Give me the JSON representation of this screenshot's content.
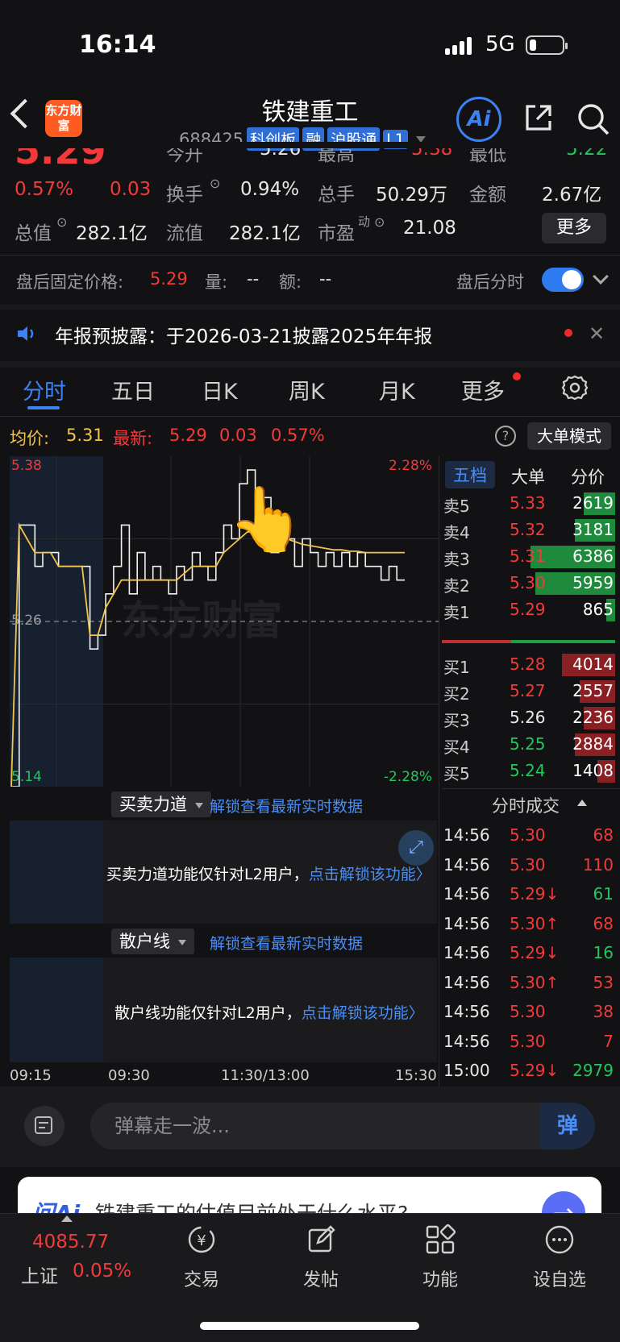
{
  "status": {
    "time": "16:14",
    "network": "5G"
  },
  "header": {
    "logo": "东方财富",
    "title": "铁建重工",
    "code": "688425",
    "tags": [
      "科创板",
      "融",
      "沪股通",
      "L1"
    ],
    "ai_label": "Ai"
  },
  "quote": {
    "price": "5.29",
    "change_pct": "0.57%",
    "change": "0.03",
    "r0": {
      "open_label": "今开",
      "open": "5.26",
      "high_label": "最高",
      "high": "5.38",
      "low_label": "最低",
      "low": "5.22"
    },
    "r1": {
      "turnover_label": "换手",
      "turnover": "0.94%",
      "volume_label": "总手",
      "volume": "50.29万",
      "amount_label": "金额",
      "amount": "2.67亿"
    },
    "r2": {
      "mcap_label": "总值",
      "mcap": "282.1亿",
      "float_label": "流值",
      "float": "282.1亿",
      "pe_label": "市盈",
      "pe_sup": "动",
      "pe": "21.08"
    },
    "more_label": "更多"
  },
  "after_hours": {
    "label": "盘后固定价格:",
    "price": "5.29",
    "vol_label": "量:",
    "vol": "--",
    "amt_label": "额:",
    "amt": "--",
    "toggle_label": "盘后分时"
  },
  "notice": {
    "text": "年报预披露：于2026-03-21披露2025年年报"
  },
  "tabs": [
    "分时",
    "五日",
    "日K",
    "周K",
    "月K",
    "更多"
  ],
  "price_line": {
    "avg_label": "均价:",
    "avg": "5.31",
    "latest_label": "最新:",
    "latest": "5.29",
    "change": "0.03",
    "pct": "0.57%",
    "mode_label": "大单模式"
  },
  "chart_labels": {
    "high": "5.38",
    "high_pct": "2.28%",
    "mid": "5.26",
    "low": "5.14",
    "low_pct": "-2.28%",
    "watermark": "东方财富"
  },
  "chart_data": {
    "type": "line",
    "ylim": [
      5.14,
      5.38
    ],
    "prev_close": 5.26,
    "series": [
      {
        "values": [
          5.14,
          5.33,
          5.33,
          5.3,
          5.31,
          5.31,
          5.3,
          5.3,
          5.3,
          5.3,
          5.24,
          5.25,
          5.28,
          5.3,
          5.33,
          5.28,
          5.31,
          5.29,
          5.3,
          5.29,
          5.28,
          5.3,
          5.29,
          5.31,
          5.3,
          5.29,
          5.31,
          5.33,
          5.32,
          5.36,
          5.37,
          5.34,
          5.35,
          5.31,
          5.33,
          5.32,
          5.3,
          5.32,
          5.31,
          5.3,
          5.31,
          5.3,
          5.31,
          5.3,
          5.31,
          5.3,
          5.3,
          5.29,
          5.3,
          5.29,
          5.29
        ]
      },
      {
        "values": [
          5.14,
          5.33,
          5.32,
          5.31,
          5.31,
          5.31,
          5.3,
          5.3,
          5.3,
          5.3,
          5.25,
          5.25,
          5.27,
          5.28,
          5.29,
          5.29,
          5.29,
          5.29,
          5.29,
          5.29,
          5.29,
          5.29,
          5.295,
          5.3,
          5.3,
          5.3,
          5.3,
          5.31,
          5.315,
          5.32,
          5.325,
          5.325,
          5.325,
          5.325,
          5.322,
          5.32,
          5.318,
          5.316,
          5.315,
          5.314,
          5.313,
          5.312,
          5.312,
          5.311,
          5.311,
          5.31,
          5.31,
          5.31,
          5.31,
          5.31,
          5.31
        ]
      }
    ]
  },
  "order_book": {
    "tabs": [
      "五档",
      "大单",
      "分价"
    ],
    "asks": [
      {
        "label": "卖5",
        "price": "5.33",
        "vol": "2619",
        "fill": 0.35
      },
      {
        "label": "卖4",
        "price": "5.32",
        "vol": "3181",
        "fill": 0.45
      },
      {
        "label": "卖3",
        "price": "5.31",
        "vol": "6386",
        "fill": 0.95
      },
      {
        "label": "卖2",
        "price": "5.30",
        "vol": "5959",
        "fill": 0.9
      },
      {
        "label": "卖1",
        "price": "5.29",
        "vol": "865",
        "fill": 0.1
      }
    ],
    "bids": [
      {
        "label": "买1",
        "price": "5.28",
        "vol": "4014",
        "fill": 0.6
      },
      {
        "label": "买2",
        "price": "5.27",
        "vol": "2557",
        "fill": 0.4
      },
      {
        "label": "买3",
        "price": "5.26",
        "vol": "2236",
        "fill": 0.35
      },
      {
        "label": "买4",
        "price": "5.25",
        "vol": "2884",
        "fill": 0.45
      },
      {
        "label": "买5",
        "price": "5.24",
        "vol": "1408",
        "fill": 0.2
      }
    ]
  },
  "trades": {
    "title": "分时成交",
    "rows": [
      {
        "time": "14:56",
        "price": "5.30",
        "vol": "68",
        "dir": ""
      },
      {
        "time": "14:56",
        "price": "5.30",
        "vol": "110",
        "dir": ""
      },
      {
        "time": "14:56",
        "price": "5.29↓",
        "vol": "61",
        "dir": "down"
      },
      {
        "time": "14:56",
        "price": "5.30↑",
        "vol": "68",
        "dir": "up"
      },
      {
        "time": "14:56",
        "price": "5.29↓",
        "vol": "16",
        "dir": "down"
      },
      {
        "time": "14:56",
        "price": "5.30↑",
        "vol": "53",
        "dir": "up"
      },
      {
        "time": "14:56",
        "price": "5.30",
        "vol": "38",
        "dir": ""
      },
      {
        "time": "14:56",
        "price": "5.30",
        "vol": "7",
        "dir": ""
      },
      {
        "time": "15:00",
        "price": "5.29↓",
        "vol": "2979",
        "dir": "down"
      }
    ]
  },
  "panels": {
    "force": {
      "label": "买卖力道",
      "unlock": "解锁查看最新实时数据",
      "text": "买卖力道功能仅针对L2用户，",
      "link": "点击解锁该功能"
    },
    "retail": {
      "label": "散户线",
      "unlock": "解锁查看最新实时数据",
      "text": "散户线功能仅针对L2用户，",
      "link": "点击解锁该功能"
    }
  },
  "time_axis": [
    "09:15",
    "09:30",
    "11:30/13:00",
    "15:30"
  ],
  "comment": {
    "placeholder": "弹幕走一波...",
    "btn": "弹"
  },
  "ai_banner": {
    "logo": "问Ai",
    "question": "铁建重工的估值目前处于什么水平?"
  },
  "bottom_nav": {
    "index_value": "4085.77",
    "index_name": "上证",
    "index_pct": "0.05%",
    "items": [
      "交易",
      "发帖",
      "功能",
      "设自选"
    ]
  },
  "colors": {
    "up": "#f23a3a",
    "down": "#22c55e",
    "accent": "#3b82f6",
    "avg_line": "#f2c44a"
  }
}
